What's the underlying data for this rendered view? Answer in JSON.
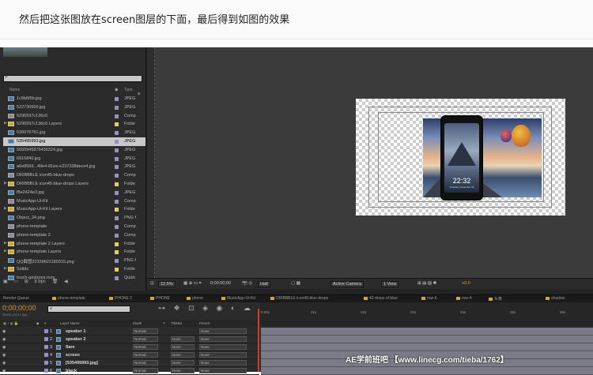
{
  "caption": "然后把这张图放在screen图层的下面，最后得到如图的效果",
  "project": {
    "columns": {
      "name": "Name",
      "type": "Type"
    },
    "items": [
      {
        "name": "1c9b6f5b.jpg",
        "type": "JPEG",
        "kind": "img",
        "label": "#9a8cc8"
      },
      {
        "name": "522730509.jpg",
        "type": "JPEG",
        "kind": "img",
        "label": "#9a8cc8"
      },
      {
        "name": "5295597c136c6",
        "type": "Comp",
        "kind": "comp",
        "label": "#9a8cc8"
      },
      {
        "name": "5295597c136c6 Layers",
        "type": "Folde",
        "kind": "folder",
        "label": "#e8d24a"
      },
      {
        "name": "530076781.jpg",
        "type": "JPEG",
        "kind": "img",
        "label": "#9a8cc8"
      },
      {
        "name": "535495993.jpg",
        "type": "JPEG",
        "kind": "img",
        "label": "#9a8cc8",
        "selected": true
      },
      {
        "name": "5650945875436324.jpg",
        "type": "JPEG",
        "kind": "img",
        "label": "#9a8cc8"
      },
      {
        "name": "6916840.jpg",
        "type": "JPEG",
        "kind": "img",
        "label": "#9a8cc8"
      },
      {
        "name": "a6e8569...49e4-81ee-e237338dece4.jpg",
        "type": "JPEG",
        "kind": "img",
        "label": "#9a8cc8"
      },
      {
        "name": "DRIBBBLE icon45-blue-drops",
        "type": "Comp",
        "kind": "comp",
        "label": "#9a8cc8"
      },
      {
        "name": "DRIBBBLE icon45-blue-drops Layers",
        "type": "Folde",
        "kind": "folder",
        "label": "#e8d24a"
      },
      {
        "name": "f8e2424e3.jpg",
        "type": "JPEG",
        "kind": "img",
        "label": "#9a8cc8"
      },
      {
        "name": "MusicApp-Ui-Kit",
        "type": "Comp",
        "kind": "comp",
        "label": "#9a8cc8"
      },
      {
        "name": "MusicApp-Ui-Kit Layers",
        "type": "Folde",
        "kind": "folder",
        "label": "#e8d24a"
      },
      {
        "name": "Object_24.png",
        "type": "PNG f",
        "kind": "img",
        "label": "#9a8cc8"
      },
      {
        "name": "phone-template",
        "type": "Comp",
        "kind": "comp",
        "label": "#9a8cc8"
      },
      {
        "name": "phone-template 2",
        "type": "Comp",
        "kind": "comp",
        "label": "#9a8cc8"
      },
      {
        "name": "phone-template 2 Layers",
        "type": "Folde",
        "kind": "folder",
        "label": "#e8d24a"
      },
      {
        "name": "phone-template Layers",
        "type": "Folde",
        "kind": "folder",
        "label": "#e8d24a"
      },
      {
        "name": "QQ截图20150621180315.png",
        "type": "PNG f",
        "kind": "img",
        "label": "#9a8cc8"
      },
      {
        "name": "Solids",
        "type": "Folde",
        "kind": "folder",
        "label": "#e8d24a"
      },
      {
        "name": "touch-gestures.mov",
        "type": "Quick",
        "kind": "img",
        "label": "#9a8cc8"
      }
    ],
    "footer_bpc": "8 bpc"
  },
  "viewer": {
    "zoom": "12.5%",
    "timecode": "0;00;00;00",
    "resolution": "Half",
    "camera": "Active Camera",
    "views": "1 View",
    "exposure": "+0.0",
    "phone_time": "22:32",
    "phone_date": "Tuesday, November 19"
  },
  "tabs": [
    "Render Queue",
    "phone-template",
    "PHONE 2",
    "PHONE",
    "phone",
    "MusicApp-Ui-Kit",
    "DRIBBBLE icon45-blue-drops",
    "42 drops of blue",
    "row-6",
    "row-4",
    "头像",
    "shadow"
  ],
  "timeline": {
    "timecode": "0;00;00;00",
    "fps": "00000 (29.97 fps)",
    "columns": {
      "layer_name": "Layer Name",
      "mode": "Mode",
      "t": "T",
      "trkmat": "TrkMat",
      "parent": "Parent"
    },
    "ruler": [
      "0:00s",
      "01s",
      "02s",
      "03s",
      "04s",
      "05s",
      "06s"
    ],
    "layers": [
      {
        "num": "1",
        "name": "speaker 1",
        "mode": "Normal",
        "trkmat": "",
        "parent": "None",
        "label": "#9a8cc8"
      },
      {
        "num": "2",
        "name": "speaker 2",
        "mode": "Normal",
        "trkmat": "None",
        "parent": "None",
        "label": "#9a8cc8"
      },
      {
        "num": "3",
        "name": "flare",
        "mode": "Normal",
        "trkmat": "None",
        "parent": "None",
        "label": "#9a8cc8"
      },
      {
        "num": "4",
        "name": "screen",
        "mode": "Normal",
        "trkmat": "None",
        "parent": "None",
        "label": "#9a8cc8"
      },
      {
        "num": "5",
        "name": "[535495993.jpg]",
        "mode": "Normal",
        "trkmat": "None",
        "parent": "None",
        "label": "#9a8cc8"
      },
      {
        "num": "6",
        "name": "black",
        "mode": "Normal",
        "trkmat": "None",
        "parent": "None",
        "label": "#9a8cc8"
      }
    ]
  },
  "watermark": "AE学前班吧 【www.linecg.com/tieba/1762】"
}
